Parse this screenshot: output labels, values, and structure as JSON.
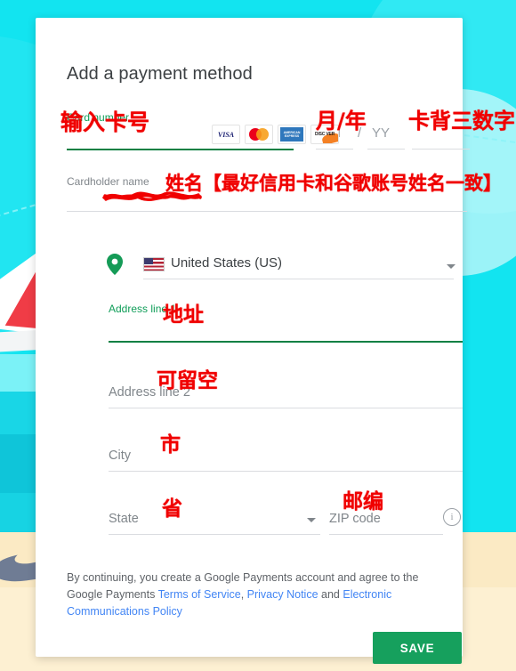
{
  "dialog": {
    "title": "Add a payment method"
  },
  "card_number": {
    "label": "Card number",
    "annotation": "输入卡号",
    "brands": [
      "VISA",
      "mastercard",
      "AMERICAN EXPRESS",
      "DISCOVER"
    ]
  },
  "expiry": {
    "month_placeholder": "MM",
    "separator": "/",
    "year_placeholder": "YY",
    "annotation": "月/年"
  },
  "cvc": {
    "annotation": "卡背三数字"
  },
  "cardholder": {
    "label": "Cardholder name",
    "value": "",
    "annotation": "姓名【最好信用卡和谷歌账号姓名一致】"
  },
  "country": {
    "icon": "location-pin-icon",
    "flag": "us-flag-icon",
    "value": "United States (US)"
  },
  "address_line1": {
    "label": "Address line 1",
    "annotation": "地址"
  },
  "address_line2": {
    "label": "Address line 2",
    "annotation": "可留空"
  },
  "city": {
    "label": "City",
    "annotation": "市"
  },
  "state": {
    "label": "State",
    "annotation": "省"
  },
  "zip": {
    "label": "ZIP code",
    "annotation": "邮编",
    "info_icon": "info-icon"
  },
  "legal": {
    "text_1": "By continuing, you create a Google Payments account and agree to the Google Payments ",
    "link_tos": "Terms of Service",
    "sep_1": ", ",
    "link_privacy": "Privacy Notice",
    "sep_2": " and ",
    "link_ecp": "Electronic Communications Policy"
  },
  "actions": {
    "save_label": "SAVE"
  },
  "colors": {
    "accent_green": "#0f9d58",
    "save_green": "#16a05d",
    "annotation_red": "#f00000",
    "link_blue": "#4285f4",
    "background_cyan": "#12e4f0",
    "sand": "#fbeac4"
  }
}
